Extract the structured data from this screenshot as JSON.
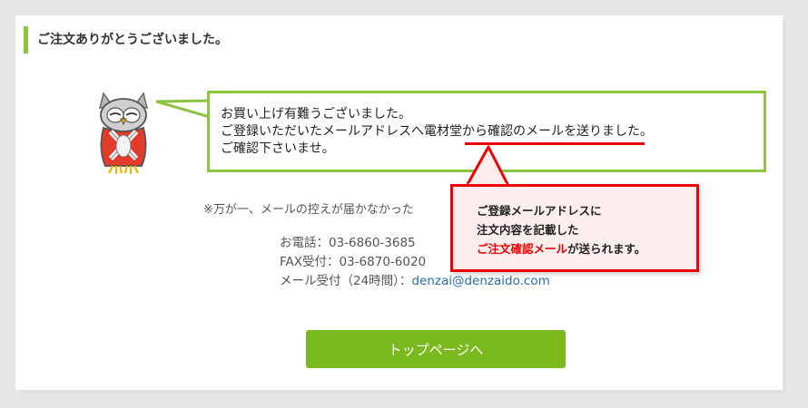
{
  "page": {
    "title": "ご注文ありがとうございました。"
  },
  "bubble": {
    "line1": "お買い上げ有難うございました。",
    "line2": "ご登録いただいたメールアドレスへ電材堂から確認のメールを送りました。",
    "line3": "ご確認下さいませ。"
  },
  "note": "※万が一、メールの控えが届かなかった",
  "contact": {
    "phone": "お電話：03-6860-3685",
    "fax": "FAX受付：03-6870-6020",
    "mail_label": "メール受付（24時間）：",
    "mail_address": "denzai@denzaido.com"
  },
  "callout": {
    "line1": "ご登録メールアドレスに",
    "line2": "注文内容を記載した",
    "line3_highlight": "ご注文確認メール",
    "line3_rest": "が送られます。"
  },
  "button": {
    "top_label": "トップページへ"
  },
  "colors": {
    "accent_green": "#8cc63f",
    "button_green": "#7aba1e",
    "callout_red": "#e00000",
    "link_blue": "#2a6db0"
  },
  "icons": {
    "mascot": "owl-mascot-icon"
  }
}
